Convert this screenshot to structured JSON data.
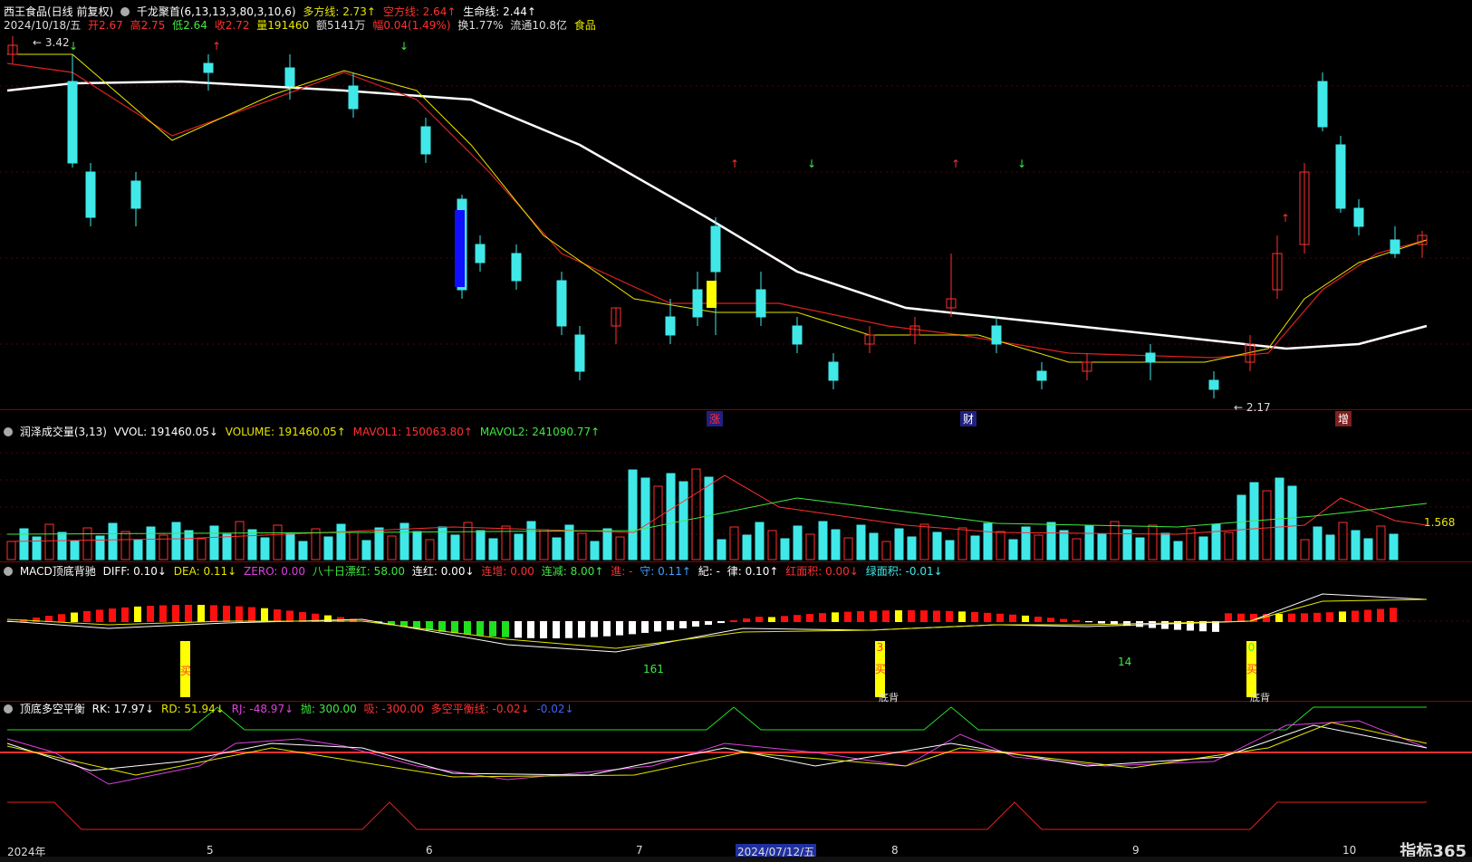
{
  "header": {
    "stock": "西王食品(日线 前复权)",
    "indicator": "千龙聚首(6,13,13,3,80,3,10,6)",
    "duo": "多方线: 2.73↑",
    "kong": "空方线: 2.64↑",
    "life": "生命线: 2.44↑",
    "date": "2024/10/18/五",
    "open": "开2.67",
    "high": "高2.75",
    "low": "低2.64",
    "close": "收2.72",
    "vol": "量191460",
    "amount": "额5141万",
    "change": "幅0.04(1.49%)",
    "turnover": "换1.77%",
    "float": "流通10.8亿",
    "sector": "食品"
  },
  "price_labels": {
    "max": "3.42",
    "min": "2.17",
    "tag_zhang": "涨",
    "tag_cai": "财",
    "tag_zeng": "增"
  },
  "volume_header": {
    "name": "润泽成交量(3,13)",
    "vvol": "VVOL: 191460.05↓",
    "volume": "VOLUME: 191460.05↑",
    "mavol1": "MAVOL1: 150063.80↑",
    "mavol2": "MAVOL2: 241090.77↑",
    "ratio": "1.568"
  },
  "macd_header": {
    "name": "MACD顶底背驰",
    "diff": "DIFF: 0.10↓",
    "dea": "DEA: 0.11↓",
    "zero": "ZERO: 0.00",
    "bashi": "八十日漂红: 58.00",
    "lianhong": "连红: 0.00↓",
    "lianzeng": "连增: 0.00",
    "lianjian": "连减: 8.00↑",
    "jin": "進: -",
    "shou": "守: 0.11↑",
    "ji": "紀: -",
    "lv": "律: 0.10↑",
    "hongmj": "红面积: 0.00↓",
    "lvmj": "绿面积: -0.01↓",
    "mark_161": "161",
    "mark_14": "14",
    "buy": "买",
    "dibei": "底背",
    "num3": "3",
    "num0": "0"
  },
  "rk_header": {
    "name": "顶底多空平衡",
    "rk": "RK: 17.97↓",
    "rd": "RD: 51.94↓",
    "rj": "RJ: -48.97↓",
    "pao": "抛: 300.00",
    "xi": "吸: -300.00",
    "balance": "多空平衡线: -0.02↓",
    "extra": "-0.02↓"
  },
  "xaxis": {
    "labels": [
      "2024年",
      "5",
      "6",
      "7",
      "8",
      "9",
      "10"
    ],
    "cursor_date": "2024/07/12/五"
  },
  "logo": "指标365",
  "colors": {
    "up": "#ff3030",
    "down": "#40e8e8",
    "ma_yellow": "#e6e600",
    "ma_red": "#e02020",
    "ma_white": "#ffffff"
  }
}
